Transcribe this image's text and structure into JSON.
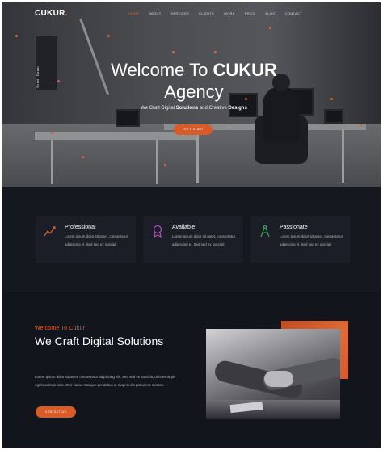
{
  "brand": {
    "name": "CUKUR",
    "dot": "."
  },
  "nav": {
    "items": [
      {
        "label": "HOME",
        "active": true
      },
      {
        "label": "ABOUT"
      },
      {
        "label": "SERVICES"
      },
      {
        "label": "CLIENTS"
      },
      {
        "label": "WORK"
      },
      {
        "label": "PRICE"
      },
      {
        "label": "BLOG"
      },
      {
        "label": "CONTACT"
      }
    ]
  },
  "hero": {
    "side_text": "Scroll Down",
    "title_prefix": "Welcome To",
    "title_brand": "CUKUR",
    "title_line2": "Agency",
    "sub_prefix": "We Craft Digital",
    "sub_b1": "Solutions",
    "sub_mid": "and Creative",
    "sub_b2": "Designs",
    "button": "LET'S START"
  },
  "features": [
    {
      "title": "Professional",
      "desc": "Lorem ipsum dolor sit amet, consectetur adipiscing el. Sed sed ex suscipit",
      "icon": "chart-line-icon"
    },
    {
      "title": "Available",
      "desc": "Lorem ipsum dolor sit amet, consectetur adipiscing el. Sed sed ex suscipit",
      "icon": "award-icon"
    },
    {
      "title": "Passionate",
      "desc": "Lorem ipsum dolor sit amet, consectetur adipiscing el. Sed sed ex suscipit",
      "icon": "compass-icon"
    }
  ],
  "about": {
    "eyebrow": "Welcome To Cukur",
    "title": "We Craft Digital Solutions",
    "text": "Lorem ipsum dolor sit amet, consectetur adipiscing elit. Sed sed ex suscipit, ultrices turpis egetmaximus ante. Orci varius natoque penatibus et magnis dis parturient montes.",
    "button": "CONTACT US"
  },
  "colors": {
    "accent": "#e0632a",
    "bg": "#13151c",
    "card": "#1c1e27"
  }
}
